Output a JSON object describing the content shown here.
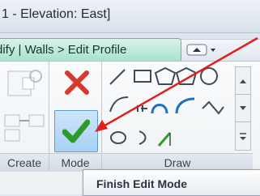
{
  "window": {
    "title": "1 - Elevation: East]"
  },
  "context_tab": {
    "label": "dify | Walls > Edit Profile"
  },
  "panels": {
    "create": {
      "label": "Create"
    },
    "mode": {
      "label": "Mode"
    },
    "draw": {
      "label": "Draw"
    }
  },
  "tooltip": {
    "text": "Finish Edit Mode"
  },
  "colors": {
    "annotation_arrow": "#e0201a",
    "finish_check": "#2e9a2a",
    "cancel_x": "#d8382e"
  }
}
